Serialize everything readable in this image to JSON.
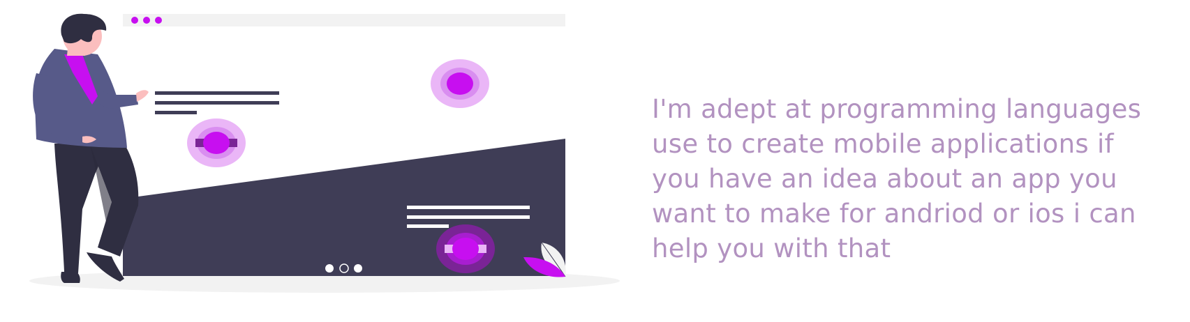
{
  "intro": {
    "text": "I'm adept at programming languages use to create mobile applications if you have an idea about an app you want to make for andriod or ios i can help you with that"
  },
  "colors": {
    "accent": "#c70ff0",
    "accent_light": "#eab6f7",
    "accent_mid": "#d98ef0",
    "accent_dark": "#7a2496",
    "dark_panel": "#3f3d56",
    "page_text": "#b292c0",
    "skin": "#fbbebe",
    "hair": "#2f2e41",
    "jacket": "#575a89",
    "ground": "#f2f2f2"
  },
  "browser_dots": [
    "dot",
    "dot",
    "dot"
  ],
  "carousel": {
    "total": 3,
    "active_index": 1
  },
  "icons": [
    "person-illustration",
    "target-icon",
    "leaf-icon"
  ]
}
